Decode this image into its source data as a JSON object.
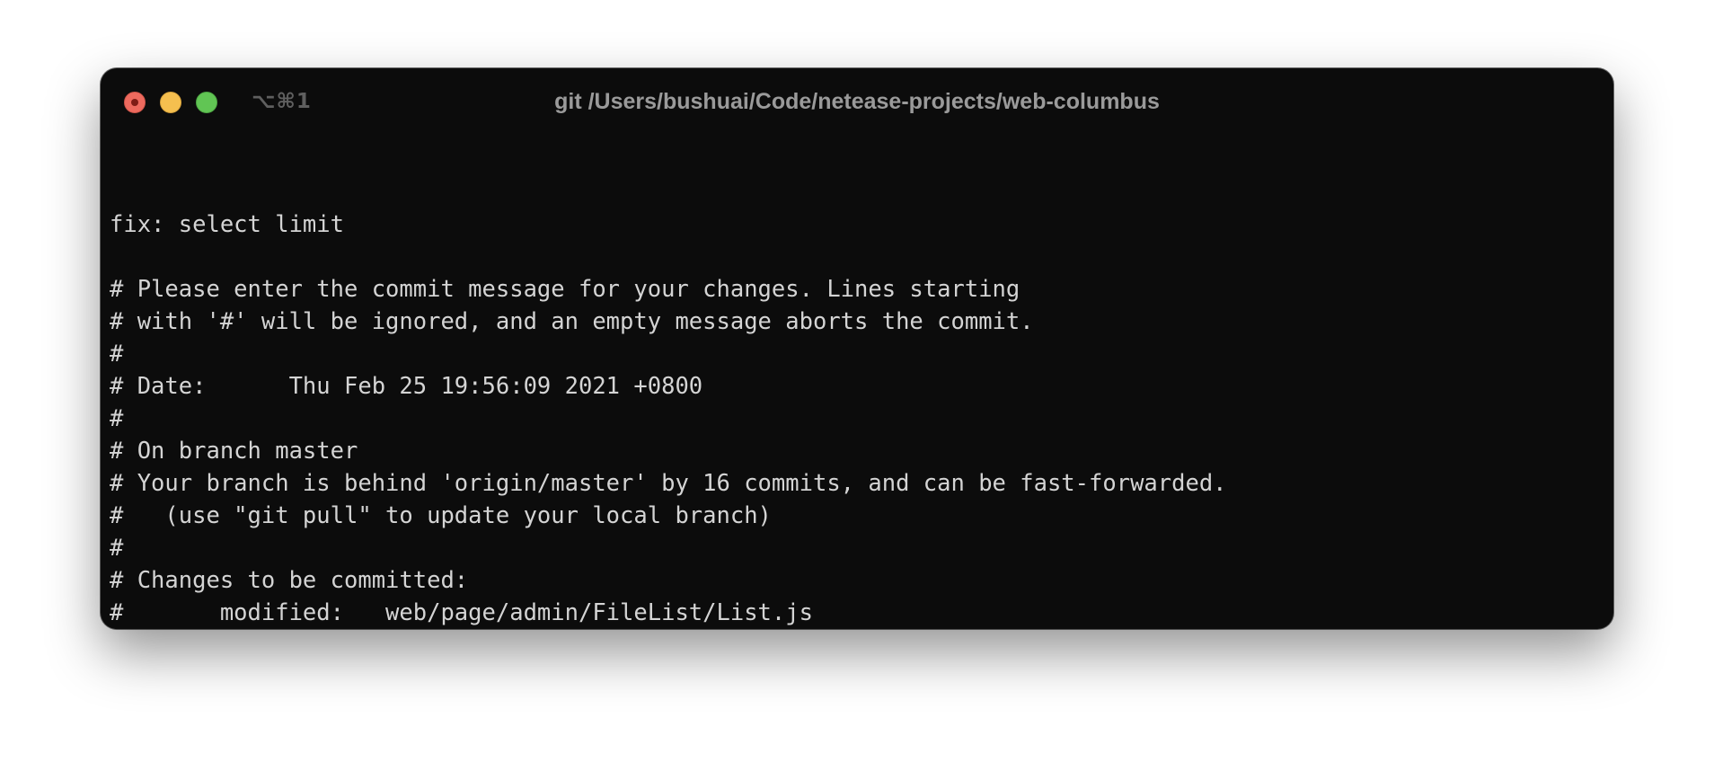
{
  "window": {
    "shortcut": "⌥⌘1",
    "title": "git /Users/bushuai/Code/netease-projects/web-columbus"
  },
  "terminal": {
    "lines": [
      "fix: select limit",
      "",
      "# Please enter the commit message for your changes. Lines starting",
      "# with '#' will be ignored, and an empty message aborts the commit.",
      "#",
      "# Date:      Thu Feb 25 19:56:09 2021 +0800",
      "#",
      "# On branch master",
      "# Your branch is behind 'origin/master' by 16 commits, and can be fast-forwarded.",
      "#   (use \"git pull\" to update your local branch)",
      "#",
      "# Changes to be committed:",
      "#       modified:   web/page/admin/FileList/List.js",
      "#"
    ]
  }
}
